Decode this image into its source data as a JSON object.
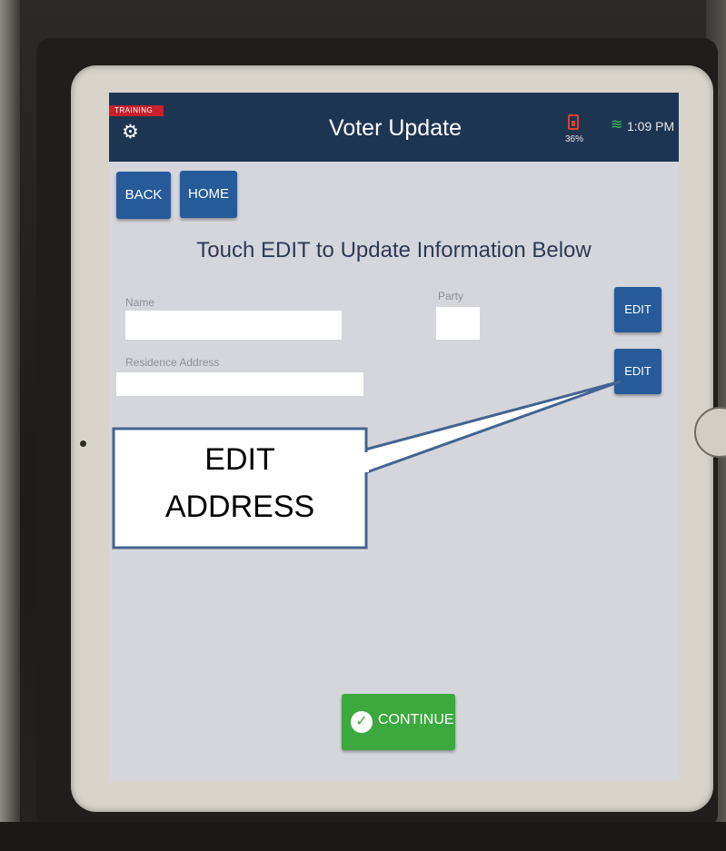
{
  "screen": {
    "badge": "TRAINING",
    "title": "Voter Update",
    "battery_percent": "36%",
    "time": "1:09 PM",
    "icons": {
      "settings": "gear-icon",
      "battery": "battery-icon",
      "wifi": "wifi-icon",
      "continue": "check-circle-icon"
    },
    "nav": {
      "back_label": "BACK",
      "home_label": "HOME"
    },
    "instruction": "Touch EDIT to Update Information Below",
    "fields": {
      "name_label": "Name",
      "party_label": "Party",
      "address_label": "Residence Address"
    },
    "edit_label": "EDIT",
    "continue_label": "CONTINUE"
  },
  "callout": {
    "line1": "EDIT",
    "line2": "ADDRESS"
  },
  "colors": {
    "header": "#1e3552",
    "button_blue": "#265a99",
    "continue_green": "#3ca93f",
    "training_red": "#c8202c"
  }
}
